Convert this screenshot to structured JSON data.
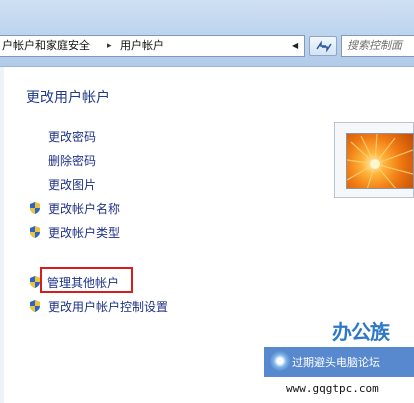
{
  "address_bar": {
    "breadcrumbs": [
      "户帐户和家庭安全",
      "用户帐户"
    ],
    "search_placeholder": "搜索控制面"
  },
  "main": {
    "title": "更改用户帐户",
    "links": [
      {
        "label": "更改密码",
        "shield": false
      },
      {
        "label": "删除密码",
        "shield": false
      },
      {
        "label": "更改图片",
        "shield": false
      },
      {
        "label": "更改帐户名称",
        "shield": true
      },
      {
        "label": "更改帐户类型",
        "shield": true
      }
    ],
    "other_links": [
      {
        "label": "管理其他帐户",
        "shield": true,
        "highlighted": true
      },
      {
        "label": "更改用户帐户控制设置",
        "shield": true
      }
    ]
  },
  "watermark": {
    "logo": "办公族",
    "forum": "过期避头电脑论坛",
    "url": "www.gqgtpc.com"
  }
}
